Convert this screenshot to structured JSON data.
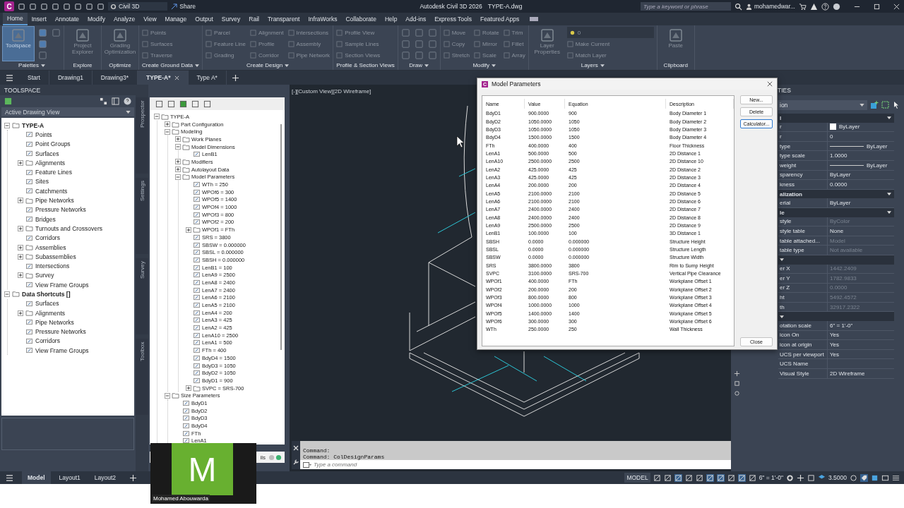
{
  "title_bar": {
    "app_badge": "C",
    "workspace": "Civil 3D",
    "share": "Share",
    "app_title": "Autodesk Civil 3D 2026",
    "file_title": "TYPE-A.dwg",
    "search": {
      "placeholder": "Type a keyword or phrase"
    },
    "user": "mohamedwar..."
  },
  "ribbon": {
    "tabs": [
      {
        "label": "Home",
        "selected": true
      },
      {
        "label": "Insert",
        "selected": false
      },
      {
        "label": "Annotate",
        "selected": false
      },
      {
        "label": "Modify",
        "selected": false
      },
      {
        "label": "Analyze",
        "selected": false
      },
      {
        "label": "View",
        "selected": false
      },
      {
        "label": "Manage",
        "selected": false
      },
      {
        "label": "Output",
        "selected": false
      },
      {
        "label": "Survey",
        "selected": false
      },
      {
        "label": "Rail",
        "selected": false
      },
      {
        "label": "Transparent",
        "selected": false
      },
      {
        "label": "InfraWorks",
        "selected": false
      },
      {
        "label": "Collaborate",
        "selected": false
      },
      {
        "label": "Help",
        "selected": false
      },
      {
        "label": "Add-ins",
        "selected": false
      },
      {
        "label": "Express Tools",
        "selected": false
      },
      {
        "label": "Featured Apps",
        "selected": false
      }
    ],
    "panels": [
      {
        "title": "Palettes",
        "menu": true,
        "tools": [
          {
            "label": "Toolspace",
            "kind": "large",
            "on": true
          },
          {
            "kind": "icon",
            "on": true
          },
          {
            "kind": "icon",
            "on": true
          },
          {
            "kind": "icon",
            "on": false
          },
          {
            "kind": "icon",
            "on": false
          }
        ]
      },
      {
        "title": "Explore",
        "menu": false,
        "tools": [
          {
            "label": "Project Explorer",
            "kind": "large",
            "on": false
          }
        ]
      },
      {
        "title": "Optimize",
        "menu": false,
        "tools": [
          {
            "label": "Grading Optimization",
            "kind": "large",
            "on": false
          }
        ]
      },
      {
        "title": "Create Ground Data",
        "menu": true,
        "tools": [
          {
            "label": "Points",
            "kind": "small",
            "on": false
          },
          {
            "label": "Surfaces",
            "kind": "small",
            "on": false
          },
          {
            "label": "Traverse",
            "kind": "small",
            "on": false
          }
        ]
      },
      {
        "title": "Create Design",
        "menu": true,
        "tools": [
          {
            "label": "Parcel",
            "kind": "small",
            "on": false
          },
          {
            "label": "Feature Line",
            "kind": "small",
            "on": false
          },
          {
            "label": "Grading",
            "kind": "small",
            "on": false
          },
          {
            "label": "Alignment",
            "kind": "small",
            "on": false
          },
          {
            "label": "Profile",
            "kind": "small",
            "on": false
          },
          {
            "label": "Corridor",
            "kind": "small",
            "on": false
          },
          {
            "label": "Intersections",
            "kind": "small",
            "on": false
          },
          {
            "label": "Assembly",
            "kind": "small",
            "on": false
          },
          {
            "label": "Pipe Network",
            "kind": "small",
            "on": false
          }
        ]
      },
      {
        "title": "Profile & Section Views",
        "menu": false,
        "tools": [
          {
            "label": "Profile View",
            "kind": "small",
            "on": false
          },
          {
            "label": "Sample Lines",
            "kind": "small",
            "on": false
          },
          {
            "label": "Section Views",
            "kind": "small",
            "on": false
          }
        ]
      },
      {
        "title": "Draw",
        "menu": true,
        "tools": [
          {
            "kind": "icon",
            "on": false
          },
          {
            "kind": "icon",
            "on": false
          },
          {
            "kind": "icon",
            "on": false
          },
          {
            "kind": "icon",
            "on": false
          },
          {
            "kind": "icon",
            "on": false
          },
          {
            "kind": "icon",
            "on": false
          },
          {
            "kind": "icon",
            "on": false
          },
          {
            "kind": "icon",
            "on": false
          },
          {
            "kind": "icon",
            "on": false
          }
        ]
      },
      {
        "title": "Modify",
        "menu": true,
        "tools": [
          {
            "label": "Move",
            "kind": "small",
            "on": false
          },
          {
            "label": "Copy",
            "kind": "small",
            "on": false
          },
          {
            "label": "Stretch",
            "kind": "small",
            "on": false
          },
          {
            "label": "Rotate",
            "kind": "small",
            "on": false
          },
          {
            "label": "Mirror",
            "kind": "small",
            "on": false
          },
          {
            "label": "Scale",
            "kind": "small",
            "on": false
          },
          {
            "label": "Trim",
            "kind": "small",
            "on": false
          },
          {
            "label": "Fillet",
            "kind": "small",
            "on": false
          },
          {
            "label": "Array",
            "kind": "small",
            "on": false
          }
        ]
      },
      {
        "title": "Layers",
        "menu": true,
        "tools": [
          {
            "label": "Layer Properties",
            "kind": "large",
            "on": false
          },
          {
            "label": "0",
            "kind": "dropdown",
            "on": false
          },
          {
            "label": "Make Current",
            "kind": "small",
            "on": false
          },
          {
            "label": "Match Layer",
            "kind": "small",
            "on": false
          }
        ]
      },
      {
        "title": "Clipboard",
        "menu": false,
        "tools": [
          {
            "label": "Paste",
            "kind": "large",
            "on": false
          }
        ]
      }
    ]
  },
  "file_tabs": [
    {
      "label": "Start",
      "selected": false
    },
    {
      "label": "Drawing1",
      "selected": false
    },
    {
      "label": "Drawing3*",
      "selected": false
    },
    {
      "label": "TYPE-A*",
      "selected": true
    },
    {
      "label": "Type A*",
      "selected": false
    }
  ],
  "toolspace": {
    "title": "TOOLSPACE",
    "view": "Active Drawing View",
    "side_tabs": [
      "Prospector",
      "Settings",
      "Survey",
      "Toolbox"
    ],
    "tree": [
      {
        "label": "TYPE-A",
        "expanded": true,
        "children": [
          {
            "label": "Points"
          },
          {
            "label": "Point Groups"
          },
          {
            "label": "Surfaces"
          },
          {
            "label": "Alignments",
            "expanded": false
          },
          {
            "label": "Feature Lines"
          },
          {
            "label": "Sites"
          },
          {
            "label": "Catchments"
          },
          {
            "label": "Pipe Networks",
            "expanded": false
          },
          {
            "label": "Pressure Networks"
          },
          {
            "label": "Bridges"
          },
          {
            "label": "Turnouts and Crossovers",
            "expanded": false
          },
          {
            "label": "Corridors"
          },
          {
            "label": "Assemblies",
            "expanded": false
          },
          {
            "label": "Subassemblies",
            "expanded": false
          },
          {
            "label": "Intersections"
          },
          {
            "label": "Survey",
            "expanded": false
          },
          {
            "label": "View Frame Groups"
          }
        ]
      },
      {
        "label": "Data Shortcuts []",
        "expanded": true,
        "children": [
          {
            "label": "Surfaces"
          },
          {
            "label": "Alignments",
            "expanded": false
          },
          {
            "label": "Pipe Networks"
          },
          {
            "label": "Pressure Networks"
          },
          {
            "label": "Corridors"
          },
          {
            "label": "View Frame Groups"
          }
        ]
      }
    ]
  },
  "part_browser": {
    "details_label": "ils",
    "tree": [
      {
        "label": "TYPE-A",
        "expanded": true,
        "children": [
          {
            "label": "Part Configuration",
            "expanded": false
          },
          {
            "label": "Modeling",
            "expanded": true,
            "children": [
              {
                "label": "Work Planes",
                "expanded": false
              },
              {
                "label": "Model Dimensions",
                "expanded": true,
                "children": [
                  {
                    "label": "LenB1"
                  }
                ]
              },
              {
                "label": "Modifiers",
                "expanded": false
              },
              {
                "label": "Autolayout Data",
                "expanded": false
              },
              {
                "label": "Model Parameters",
                "expanded": true,
                "children": [
                  {
                    "label": "WTh = 250"
                  },
                  {
                    "label": "WPOf6 = 300"
                  },
                  {
                    "label": "WPOf5 = 1400"
                  },
                  {
                    "label": "WPOf4 = 1000"
                  },
                  {
                    "label": "WPOf3 = 800"
                  },
                  {
                    "label": "WPOf2 = 200"
                  },
                  {
                    "label": "WPOf1 = FTh",
                    "expanded": false
                  },
                  {
                    "label": "SRS = 3800"
                  },
                  {
                    "label": "SBSW = 0.000000"
                  },
                  {
                    "label": "SBSL = 0.000000"
                  },
                  {
                    "label": "SBSH = 0.000000"
                  },
                  {
                    "label": "LenB1 = 100"
                  },
                  {
                    "label": "LenA9 = 2500"
                  },
                  {
                    "label": "LenA8 = 2400"
                  },
                  {
                    "label": "LenA7 = 2400"
                  },
                  {
                    "label": "LenA6 = 2100"
                  },
                  {
                    "label": "LenA5 = 2100"
                  },
                  {
                    "label": "LenA4 = 200"
                  },
                  {
                    "label": "LenA3 = 425"
                  },
                  {
                    "label": "LenA2 = 425"
                  },
                  {
                    "label": "LenA10 = 2500"
                  },
                  {
                    "label": "LenA1 = 500"
                  },
                  {
                    "label": "FTh = 400"
                  },
                  {
                    "label": "BdyD4 = 1500"
                  },
                  {
                    "label": "BdyD3 = 1050"
                  },
                  {
                    "label": "BdyD2 = 1050"
                  },
                  {
                    "label": "BdyD1 = 900"
                  },
                  {
                    "label": "SVPC = SRS-700",
                    "expanded": false
                  }
                ]
              }
            ]
          },
          {
            "label": "Size Parameters",
            "expanded": true,
            "children": [
              {
                "label": "BdyD1"
              },
              {
                "label": "BdyD2"
              },
              {
                "label": "BdyD3"
              },
              {
                "label": "BdyD4"
              },
              {
                "label": "FTh"
              },
              {
                "label": "LenA1"
              }
            ]
          }
        ]
      }
    ]
  },
  "viewport": {
    "label": "[-][Custom View][2D Wireframe]"
  },
  "command_line": {
    "history": [
      "Command:",
      "Command: ColDesignParams"
    ],
    "placeholder": "Type a command"
  },
  "dialog": {
    "icon_letter": "C",
    "title": "Model Parameters",
    "columns": [
      "Name",
      "Value",
      "Equation",
      "Description"
    ],
    "rows": [
      [
        "BdyD1",
        "900.0000",
        "900",
        "Body Diameter 1"
      ],
      [
        "BdyD2",
        "1050.0000",
        "1050",
        "Body Diameter 2"
      ],
      [
        "BdyD3",
        "1050.0000",
        "1050",
        "Body Diameter 3"
      ],
      [
        "BdyD4",
        "1500.0000",
        "1500",
        "Body Diameter 4"
      ],
      [
        "FTh",
        "400.0000",
        "400",
        "Floor Thickness"
      ],
      [
        "LenA1",
        "500.0000",
        "500",
        "2D Distance 1"
      ],
      [
        "LenA10",
        "2500.0000",
        "2500",
        "2D Distance 10"
      ],
      [
        "LenA2",
        "425.0000",
        "425",
        "2D Distance 2"
      ],
      [
        "LenA3",
        "425.0000",
        "425",
        "2D Distance 3"
      ],
      [
        "LenA4",
        "200.0000",
        "200",
        "2D Distance 4"
      ],
      [
        "LenA5",
        "2100.0000",
        "2100",
        "2D Distance 5"
      ],
      [
        "LenA6",
        "2100.0000",
        "2100",
        "2D Distance 6"
      ],
      [
        "LenA7",
        "2400.0000",
        "2400",
        "2D Distance 7"
      ],
      [
        "LenA8",
        "2400.0000",
        "2400",
        "2D Distance 8"
      ],
      [
        "LenA9",
        "2500.0000",
        "2500",
        "2D Distance 9"
      ],
      [
        "LenB1",
        "100.0000",
        "100",
        "3D Distance 1"
      ],
      [
        "SBSH",
        "0.0000",
        "0.000000",
        "Structure Height"
      ],
      [
        "SBSL",
        "0.0000",
        "0.000000",
        "Structure Length"
      ],
      [
        "SBSW",
        "0.0000",
        "0.000000",
        "Structure Width"
      ],
      [
        "SRS",
        "3800.0000",
        "3800",
        "Rim to Sump Height"
      ],
      [
        "SVPC",
        "3100.0000",
        "SRS-700",
        "Vertical Pipe Clearance"
      ],
      [
        "WPOf1",
        "400.0000",
        "FTh",
        "Workplane Offset 1"
      ],
      [
        "WPOf2",
        "200.0000",
        "200",
        "Workplane Offset 2"
      ],
      [
        "WPOf3",
        "800.0000",
        "800",
        "Workplane Offset 3"
      ],
      [
        "WPOf4",
        "1000.0000",
        "1000",
        "Workplane Offset 4"
      ],
      [
        "WPOf5",
        "1400.0000",
        "1400",
        "Workplane Offset 5"
      ],
      [
        "WPOf6",
        "300.0000",
        "300",
        "Workplane Offset 6"
      ],
      [
        "WTh",
        "250.0000",
        "250",
        "Wall Thickness"
      ]
    ],
    "buttons": [
      {
        "label": "New...",
        "focused": false
      },
      {
        "label": "Delete",
        "focused": false
      },
      {
        "label": "Calculator...",
        "focused": true
      }
    ],
    "close": "Close"
  },
  "properties": {
    "title": "TIES",
    "selector": "ion",
    "sections": [
      {
        "title": "l",
        "rows": [
          {
            "label": "r",
            "value": "ByLayer",
            "kind": "swatch",
            "disabled": false
          },
          {
            "label": "r",
            "value": "0",
            "kind": "text",
            "disabled": false
          },
          {
            "label": "type",
            "value": "ByLayer",
            "kind": "line",
            "disabled": false
          },
          {
            "label": "type scale",
            "value": "1.0000",
            "kind": "text",
            "disabled": false
          },
          {
            "label": "weight",
            "value": "ByLayer",
            "kind": "line",
            "disabled": false
          },
          {
            "label": "sparency",
            "value": "ByLayer",
            "kind": "text",
            "disabled": false
          },
          {
            "label": "kness",
            "value": "0.0000",
            "kind": "text",
            "disabled": false
          }
        ]
      },
      {
        "title": "alization",
        "rows": [
          {
            "label": "erial",
            "value": "ByLayer",
            "kind": "text",
            "disabled": false
          }
        ]
      },
      {
        "title": "le",
        "rows": [
          {
            "label": "style",
            "value": "ByColor",
            "kind": "text",
            "disabled": true
          },
          {
            "label": "style table",
            "value": "None",
            "kind": "text",
            "disabled": false
          },
          {
            "label": "table attached...",
            "value": "Model",
            "kind": "text",
            "disabled": true
          },
          {
            "label": "table type",
            "value": "Not available",
            "kind": "text",
            "disabled": true
          }
        ]
      },
      {
        "rows": [
          {
            "label": "er X",
            "value": "1442.2409",
            "kind": "text",
            "disabled": true
          },
          {
            "label": "er Y",
            "value": "1782.9833",
            "kind": "text",
            "disabled": true
          },
          {
            "label": "er Z",
            "value": "0.0000",
            "kind": "text",
            "disabled": true
          },
          {
            "label": "ht",
            "value": "5492.4572",
            "kind": "text",
            "disabled": true
          },
          {
            "label": "th",
            "value": "32917.2322",
            "kind": "text",
            "disabled": true
          }
        ]
      },
      {
        "rows": [
          {
            "label": "otation scale",
            "value": "6\" = 1'-0\"",
            "kind": "text",
            "disabled": false
          },
          {
            "label": "icon On",
            "value": "Yes",
            "kind": "text",
            "disabled": false
          },
          {
            "label": "icon at origin",
            "value": "Yes",
            "kind": "text",
            "disabled": false
          },
          {
            "label": "UCS per viewport",
            "value": "Yes",
            "kind": "text",
            "disabled": false
          },
          {
            "label": "UCS Name",
            "disabled": false
          },
          {
            "label": "Visual Style",
            "value": "2D Wireframe",
            "kind": "text",
            "disabled": false
          }
        ]
      }
    ]
  },
  "status_bar": {
    "layout_tabs": [
      {
        "label": "Model",
        "selected": true
      },
      {
        "label": "Layout1",
        "selected": false
      },
      {
        "label": "Layout2",
        "selected": false
      }
    ],
    "model_label": "MODEL",
    "scale": "6\" = 1'-0\"",
    "value": "3.5000"
  },
  "webcam": {
    "initial": "M",
    "name": "Mohamed Abouwarda"
  }
}
